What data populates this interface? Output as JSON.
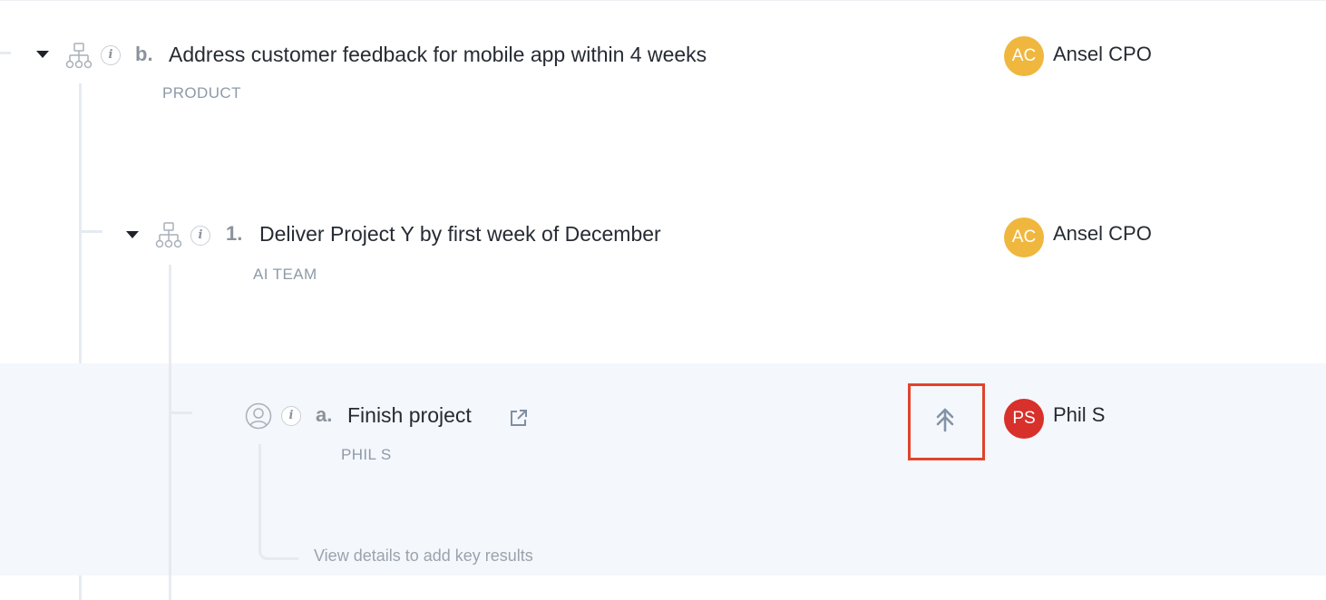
{
  "colors": {
    "accent_gold": "#f0b73e",
    "accent_red": "#d8302a",
    "highlight_bg": "#f4f7fb",
    "focus_box": "#e0442c"
  },
  "rows": [
    {
      "index": "b.",
      "title": "Address customer feedback for mobile app within 4 weeks",
      "team": "PRODUCT",
      "owner_initials": "AC",
      "owner_name": "Ansel CPO",
      "icon": "org-tree-icon"
    },
    {
      "index": "1.",
      "title": "Deliver Project Y by first week of December",
      "team": "AI TEAM",
      "owner_initials": "AC",
      "owner_name": "Ansel CPO",
      "icon": "org-tree-icon"
    },
    {
      "index": "a.",
      "title": "Finish project",
      "team": "PHIL S",
      "owner_initials": "PS",
      "owner_name": "Phil S",
      "icon": "person-icon",
      "hint": "View details to add key results"
    }
  ]
}
